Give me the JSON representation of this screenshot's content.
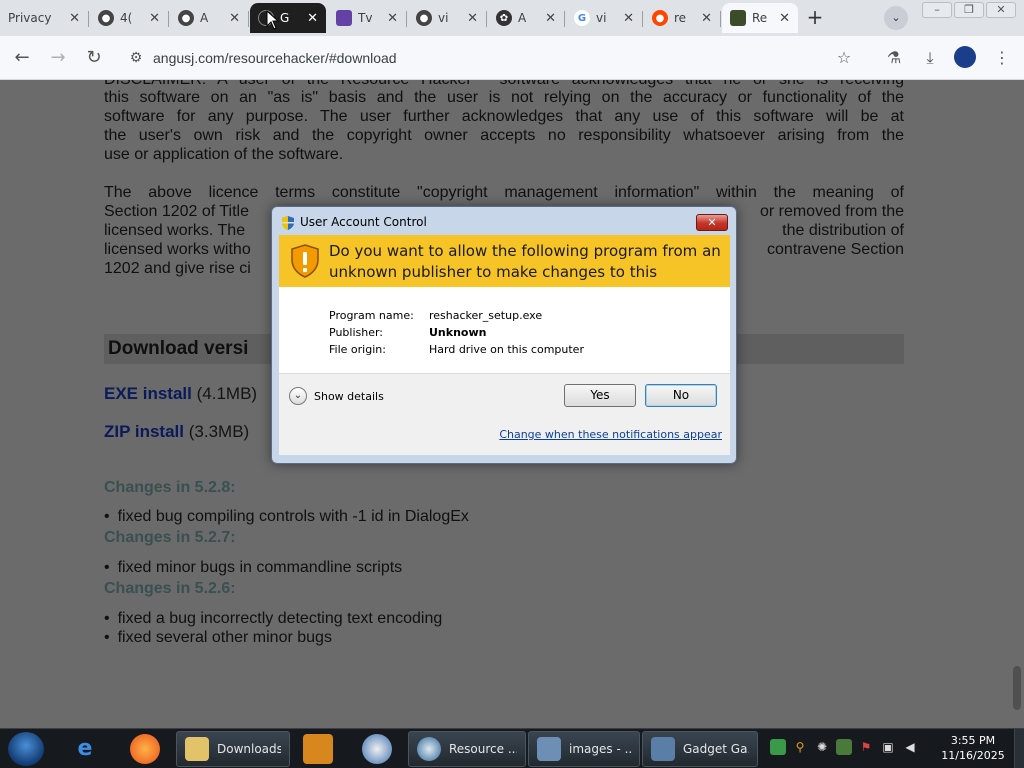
{
  "browser": {
    "tabs": [
      {
        "title": "Privacy",
        "icon": "document-icon",
        "color": "#dfe3e8"
      },
      {
        "title": "4(",
        "icon": "globe-icon",
        "color": "#444444"
      },
      {
        "title": "A",
        "icon": "globe-icon",
        "color": "#444444"
      },
      {
        "title": "G",
        "icon": "app-icon",
        "color": "#1f1f1f"
      },
      {
        "title": "Tv",
        "icon": "twitch-icon",
        "color": "#6441a5"
      },
      {
        "title": "vi",
        "icon": "globe-icon",
        "color": "#444444"
      },
      {
        "title": "A",
        "icon": "openai-icon",
        "color": "#333333"
      },
      {
        "title": "vi",
        "icon": "google-icon",
        "color": "#4285f4"
      },
      {
        "title": "re",
        "icon": "reddit-icon",
        "color": "#ff4500"
      },
      {
        "title": "Re",
        "icon": "resource-hacker-icon",
        "color": "#3c4b2a"
      }
    ],
    "close_glyph": "✕",
    "new_tab_glyph": "+",
    "url": "angusj.com/resourcehacker/#download"
  },
  "page": {
    "licence_lines": [
      "DISCLAIMER: A user of the Resource Hacker™ software acknowledges that he or she is receiving",
      "this software on an \"as is\" basis and the user is not relying on the accuracy or functionality of the",
      "software for any purpose. The user further acknowledges that any use of this software will be at",
      "the user's own risk and the copyright owner accepts no responsibility whatsoever arising from the",
      "use or application of the software."
    ],
    "licence2_lines": [
      "The above licence terms constitute \"copyright management information\" within the meaning of",
      "Section 1202 of Title",
      "licensed works. The",
      "licensed works witho",
      "1202 and give rise ci"
    ],
    "licence2_right": [
      "or removed from the",
      "the distribution of",
      "contravene Section"
    ],
    "download_title": "Download versi",
    "exe_link": "EXE install",
    "exe_size": "(4.1MB)",
    "zip_link": "ZIP install",
    "zip_size": "(3.3MB)",
    "changes": [
      {
        "heading": "Changes in 5.2.8:",
        "items": [
          "fixed bug compiling controls with -1 id in DialogEx"
        ]
      },
      {
        "heading": "Changes in 5.2.7:",
        "items": [
          "fixed minor bugs in commandline scripts"
        ]
      },
      {
        "heading": "Changes in 5.2.6:",
        "items": [
          "fixed a bug incorrectly detecting text encoding",
          "fixed several other minor bugs"
        ]
      }
    ]
  },
  "uac": {
    "title": "User Account Control",
    "question": "Do you want to allow the following program from an unknown publisher to make changes to this computer?",
    "program_name_label": "Program name:",
    "program_name_value": "reshacker_setup.exe",
    "publisher_label": "Publisher:",
    "publisher_value": "Unknown",
    "origin_label": "File origin:",
    "origin_value": "Hard drive on this computer",
    "details_label": "Show details",
    "yes_label": "Yes",
    "no_label": "No",
    "link_label": "Change when these notifications appear",
    "close_glyph": "✕"
  },
  "taskbar": {
    "items": [
      {
        "label": "Downloads",
        "icon": "folder-icon"
      },
      {
        "label": "Resource ...",
        "icon": "resource-hacker-icon"
      },
      {
        "label": "images - ...",
        "icon": "image-viewer-icon"
      },
      {
        "label": "Gadget Ga...",
        "icon": "gadget-icon"
      }
    ],
    "time": "3:55 PM",
    "date": "11/16/2025"
  }
}
